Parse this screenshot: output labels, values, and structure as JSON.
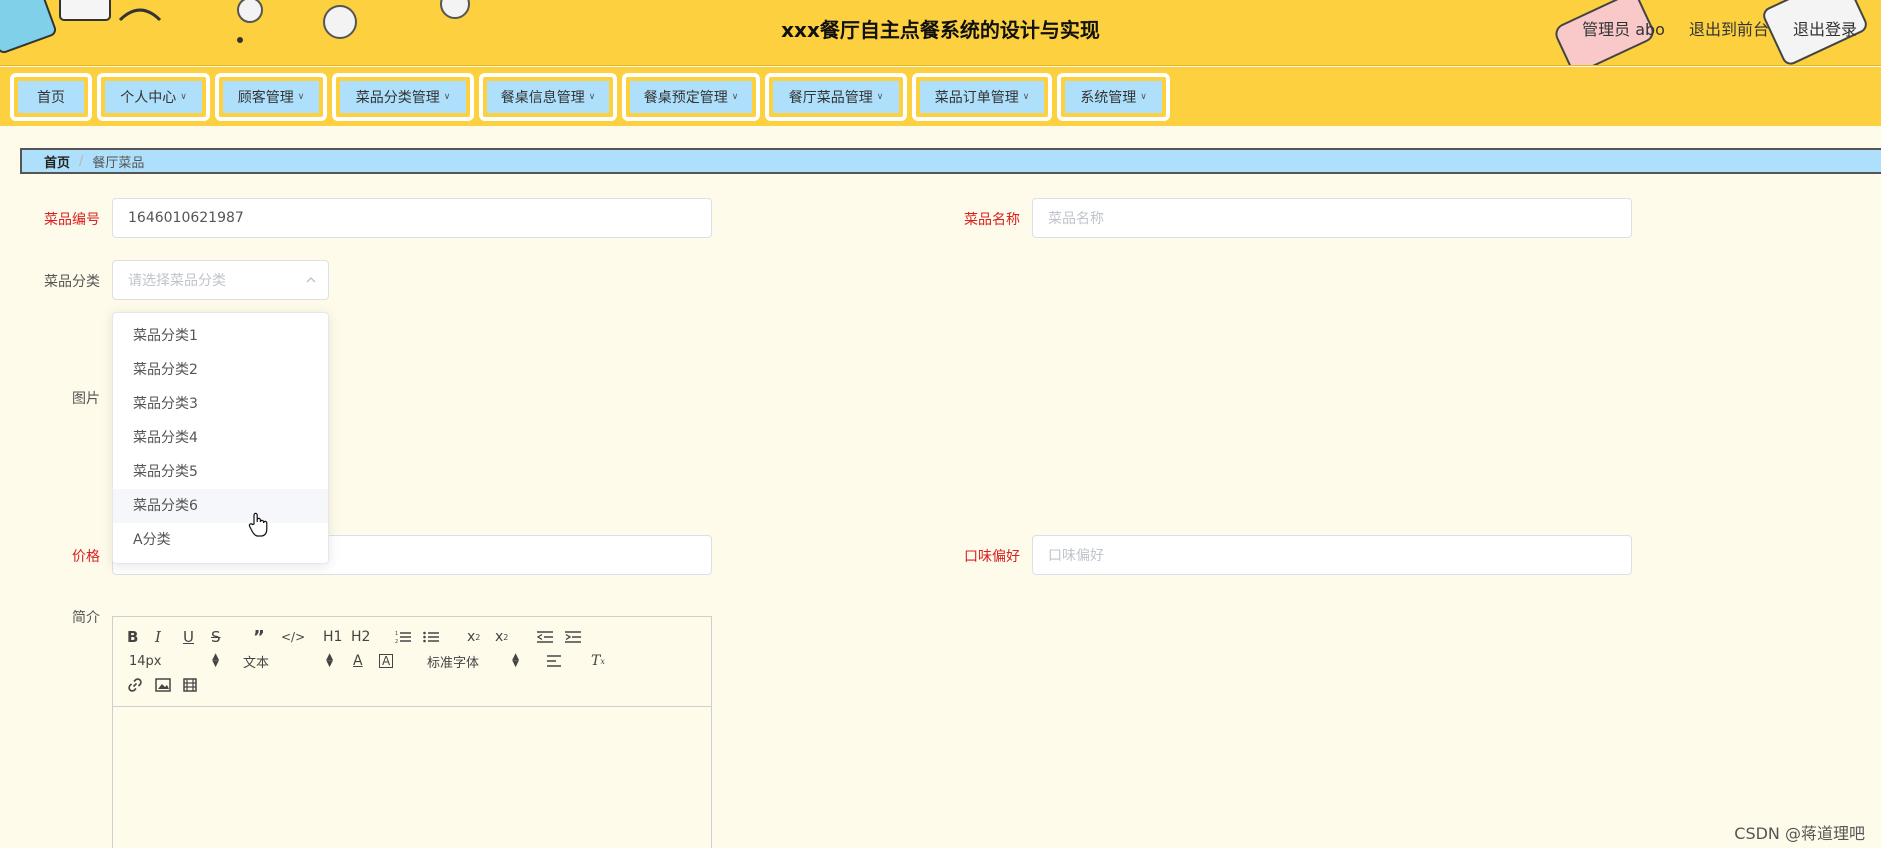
{
  "header": {
    "title": "xxx餐厅自主点餐系统的设计与实现",
    "user": "管理员 abo",
    "front_link": "退出到前台",
    "logout_link": "退出登录"
  },
  "nav": [
    {
      "label": "首页",
      "dropdown": false
    },
    {
      "label": "个人中心",
      "dropdown": true
    },
    {
      "label": "顾客管理",
      "dropdown": true
    },
    {
      "label": "菜品分类管理",
      "dropdown": true
    },
    {
      "label": "餐桌信息管理",
      "dropdown": true
    },
    {
      "label": "餐桌预定管理",
      "dropdown": true
    },
    {
      "label": "餐厅菜品管理",
      "dropdown": true
    },
    {
      "label": "菜品订单管理",
      "dropdown": true
    },
    {
      "label": "系统管理",
      "dropdown": true
    }
  ],
  "breadcrumb": {
    "home": "首页",
    "separator": "/",
    "current": "餐厅菜品"
  },
  "form": {
    "dish_no": {
      "label": "菜品编号",
      "value": "1646010621987"
    },
    "dish_name": {
      "label": "菜品名称",
      "placeholder": "菜品名称"
    },
    "category": {
      "label": "菜品分类",
      "placeholder": "请选择菜品分类"
    },
    "image": {
      "label": "图片"
    },
    "price": {
      "label": "价格"
    },
    "taste": {
      "label": "口味偏好",
      "placeholder": "口味偏好"
    },
    "intro": {
      "label": "简介"
    }
  },
  "dropdown_options": [
    "菜品分类1",
    "菜品分类2",
    "菜品分类3",
    "菜品分类4",
    "菜品分类5",
    "菜品分类6",
    "A分类"
  ],
  "dropdown_hovered_index": 5,
  "editor": {
    "font_size": "14px",
    "text_type": "文本",
    "font_family": "标准字体",
    "h1": "H1",
    "h2": "H2"
  },
  "watermark": "CSDN @蒋道理吧",
  "colors": {
    "header_bg": "#fcd03e",
    "nav_button": "#aee0fb",
    "page_bg": "#fffbea",
    "required_label": "#d82020"
  }
}
